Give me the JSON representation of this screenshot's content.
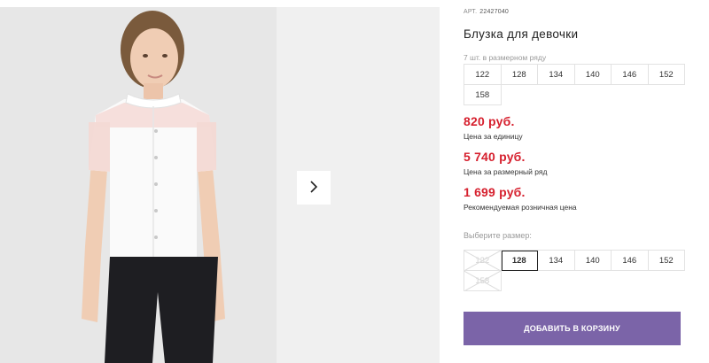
{
  "product": {
    "art_label": "АРТ.",
    "art_value": "22427040",
    "title": "Блузка для девочки",
    "in_row": "7 шт. в размерном ряду"
  },
  "row_sizes": [
    "122",
    "128",
    "134",
    "140",
    "146",
    "152",
    "158"
  ],
  "prices": [
    {
      "value": "820 руб.",
      "label": "Цена за единицу"
    },
    {
      "value": "5 740 руб.",
      "label": "Цена за размерный ряд"
    },
    {
      "value": "1 699 руб.",
      "label": "Рекомендуемая розничная цена"
    }
  ],
  "size_select": {
    "label": "Выберите размер:",
    "selected": "128",
    "sizes": [
      {
        "size": "122",
        "state": "disabled"
      },
      {
        "size": "128",
        "state": "selected"
      },
      {
        "size": "134",
        "state": "available"
      },
      {
        "size": "140",
        "state": "available"
      },
      {
        "size": "146",
        "state": "available"
      },
      {
        "size": "152",
        "state": "available"
      },
      {
        "size": "158",
        "state": "disabled"
      }
    ]
  },
  "cart_button": "ДОБАВИТЬ В КОРЗИНУ",
  "gallery": {
    "next_icon": "chevron-right-icon"
  },
  "colors": {
    "price": "#d6202e",
    "cart_button": "#7b64a8"
  }
}
